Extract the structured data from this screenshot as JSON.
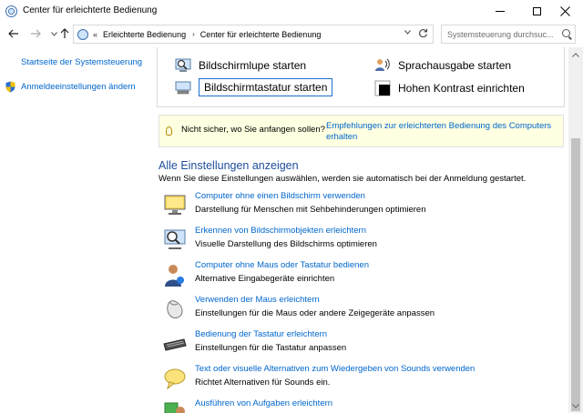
{
  "window": {
    "title": "Center für erleichterte Bedienung",
    "icon": "control-panel-icon"
  },
  "address_bar": {
    "overflow": "«",
    "crumbs": [
      "Erleichterte Bedienung",
      "Center für erleichterte Bedienung"
    ],
    "separator": "›"
  },
  "search": {
    "placeholder": "Systemsteuerung durchsuc..."
  },
  "sidebar": {
    "home_link": "Startseite der Systemsteuerung",
    "logon_link": "Anmeldeeinstellungen ändern"
  },
  "quick_access": {
    "magnifier": "Bildschirmlupe starten",
    "keyboard": "Bildschirmtastatur starten",
    "narrator": "Sprachausgabe starten",
    "high_contrast": "Hohen Kontrast einrichten"
  },
  "tip": {
    "text": "Nicht sicher, wo Sie anfangen sollen?",
    "link": "Empfehlungen zur erleichterten Bedienung des Computers erhalten"
  },
  "settings": {
    "title": "Alle Einstellungen anzeigen",
    "description": "Wenn Sie diese Einstellungen auswählen, werden sie automatisch bei der Anmeldung gestartet.",
    "items": [
      {
        "link": "Computer ohne einen Bildschirm verwenden",
        "desc": "Darstellung für Menschen mit Sehbehinderungen optimieren",
        "icon": "monitor-icon"
      },
      {
        "link": "Erkennen von Bildschirmobjekten erleichtern",
        "desc": "Visuelle Darstellung des Bildschirms optimieren",
        "icon": "magnifier-monitor-icon"
      },
      {
        "link": "Computer ohne Maus oder Tastatur bedienen",
        "desc": "Alternative Eingabegeräte einrichten",
        "icon": "person-icon"
      },
      {
        "link": "Verwenden der Maus erleichtern",
        "desc": "Einstellungen für die Maus oder andere Zeigegeräte anpassen",
        "icon": "mouse-icon"
      },
      {
        "link": "Bedienung der Tastatur erleichtern",
        "desc": "Einstellungen für die Tastatur anpassen",
        "icon": "keyboard-icon"
      },
      {
        "link": "Text oder visuelle Alternativen zum Wiedergeben von Sounds verwenden",
        "desc": "Richtet Alternativen für Sounds ein.",
        "icon": "speech-bubble-icon"
      },
      {
        "link": "Ausführen von Aufgaben erleichtern",
        "desc": "",
        "icon": "tasks-icon"
      }
    ]
  }
}
